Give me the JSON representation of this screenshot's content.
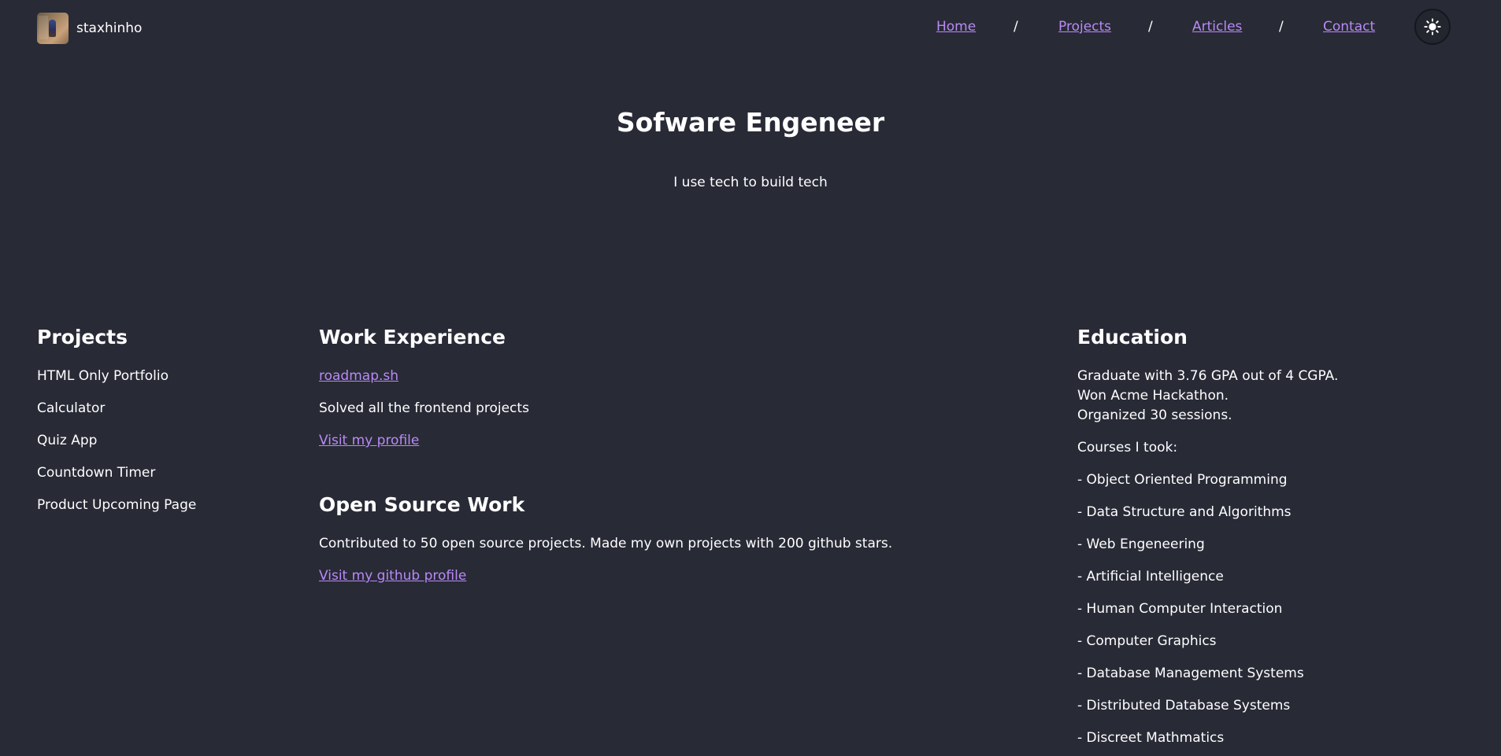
{
  "header": {
    "brand_name": "staxhinho",
    "nav": {
      "home": "Home",
      "projects": "Projects",
      "articles": "Articles",
      "contact": "Contact",
      "separator": "/"
    },
    "theme_toggle_icon": "sun-icon"
  },
  "hero": {
    "title": "Sofware Engeneer",
    "subtitle": "I use tech to build tech"
  },
  "projects": {
    "heading": "Projects",
    "items": [
      "HTML Only Portfolio",
      "Calculator",
      "Quiz App",
      "Countdown Timer",
      "Product Upcoming Page"
    ]
  },
  "work": {
    "heading": "Work Experience",
    "company_link": "roadmap.sh",
    "description": "Solved all the frontend projects",
    "profile_link": "Visit my profile"
  },
  "open_source": {
    "heading": "Open Source Work",
    "description": "Contributed to 50 open source projects. Made my own projects with 200 github stars.",
    "github_link": "Visit my github profile"
  },
  "education": {
    "heading": "Education",
    "summary": [
      "Graduate with 3.76 GPA out of 4 CGPA.",
      "Won Acme Hackathon.",
      "Organized 30 sessions."
    ],
    "courses_label": "Courses I took:",
    "courses": [
      "- Object Oriented Programming",
      "- Data Structure and Algorithms",
      "- Web Engeneering",
      "- Artificial Intelligence",
      "- Human Computer Interaction",
      "- Computer Graphics",
      "- Database Management Systems",
      "- Distributed Database Systems",
      "- Discreet Mathmatics"
    ]
  },
  "colors": {
    "background": "#282a36",
    "link": "#b98af5",
    "text": "#ffffff"
  }
}
